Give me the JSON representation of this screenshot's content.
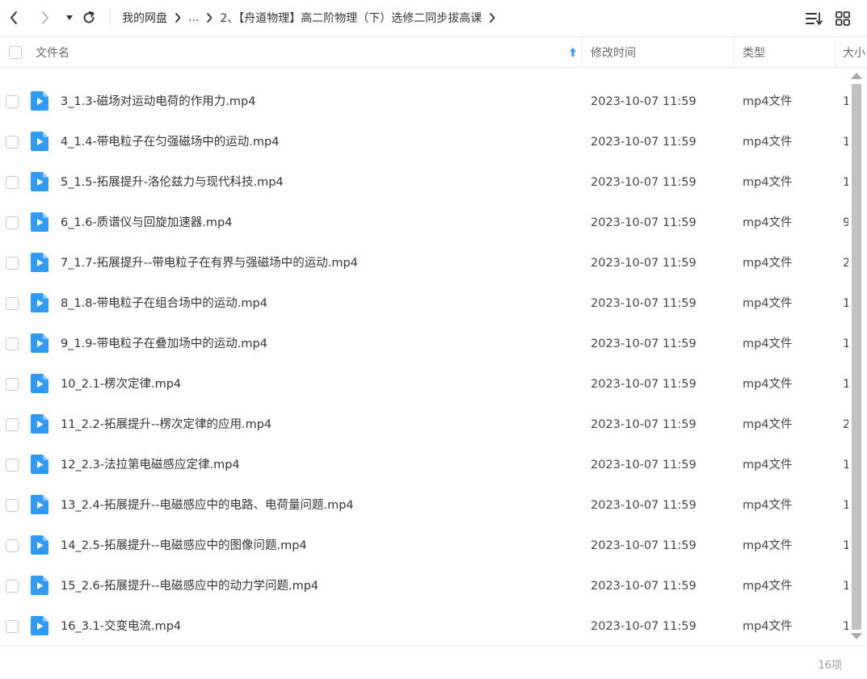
{
  "toolbar": {
    "breadcrumb": [
      "我的网盘",
      "...",
      "2、【舟道物理】高二阶物理（下）选修二同步拔高课"
    ]
  },
  "header": {
    "name": "文件名",
    "modified": "修改时间",
    "type": "类型",
    "size": "大小"
  },
  "colors": {
    "file_icon": "#2f9bf5",
    "sort_arrow": "#2f9bf5"
  },
  "files": [
    {
      "name": "3_1.3-磁场对运动电荷的作用力.mp4",
      "modified": "2023-10-07 11:59",
      "type": "mp4文件",
      "size": "1"
    },
    {
      "name": "4_1.4-带电粒子在匀强磁场中的运动.mp4",
      "modified": "2023-10-07 11:59",
      "type": "mp4文件",
      "size": "1"
    },
    {
      "name": "5_1.5-拓展提升-洛伦兹力与现代科技.mp4",
      "modified": "2023-10-07 11:59",
      "type": "mp4文件",
      "size": "1"
    },
    {
      "name": "6_1.6-质谱仪与回旋加速器.mp4",
      "modified": "2023-10-07 11:59",
      "type": "mp4文件",
      "size": "9"
    },
    {
      "name": "7_1.7-拓展提升--带电粒子在有界与强磁场中的运动.mp4",
      "modified": "2023-10-07 11:59",
      "type": "mp4文件",
      "size": "2"
    },
    {
      "name": "8_1.8-带电粒子在组合场中的运动.mp4",
      "modified": "2023-10-07 11:59",
      "type": "mp4文件",
      "size": "1"
    },
    {
      "name": "9_1.9-带电粒子在叠加场中的运动.mp4",
      "modified": "2023-10-07 11:59",
      "type": "mp4文件",
      "size": "1"
    },
    {
      "name": "10_2.1-楞次定律.mp4",
      "modified": "2023-10-07 11:59",
      "type": "mp4文件",
      "size": "1"
    },
    {
      "name": "11_2.2-拓展提升--楞次定律的应用.mp4",
      "modified": "2023-10-07 11:59",
      "type": "mp4文件",
      "size": "2"
    },
    {
      "name": "12_2.3-法拉第电磁感应定律.mp4",
      "modified": "2023-10-07 11:59",
      "type": "mp4文件",
      "size": "1"
    },
    {
      "name": "13_2.4-拓展提升--电磁感应中的电路、电荷量问题.mp4",
      "modified": "2023-10-07 11:59",
      "type": "mp4文件",
      "size": "1"
    },
    {
      "name": "14_2.5-拓展提升--电磁感应中的图像问题.mp4",
      "modified": "2023-10-07 11:59",
      "type": "mp4文件",
      "size": "1"
    },
    {
      "name": "15_2.6-拓展提升--电磁感应中的动力学问题.mp4",
      "modified": "2023-10-07 11:59",
      "type": "mp4文件",
      "size": "1"
    },
    {
      "name": "16_3.1-交变电流.mp4",
      "modified": "2023-10-07 11:59",
      "type": "mp4文件",
      "size": "1"
    }
  ],
  "footer": {
    "count": "16项"
  }
}
